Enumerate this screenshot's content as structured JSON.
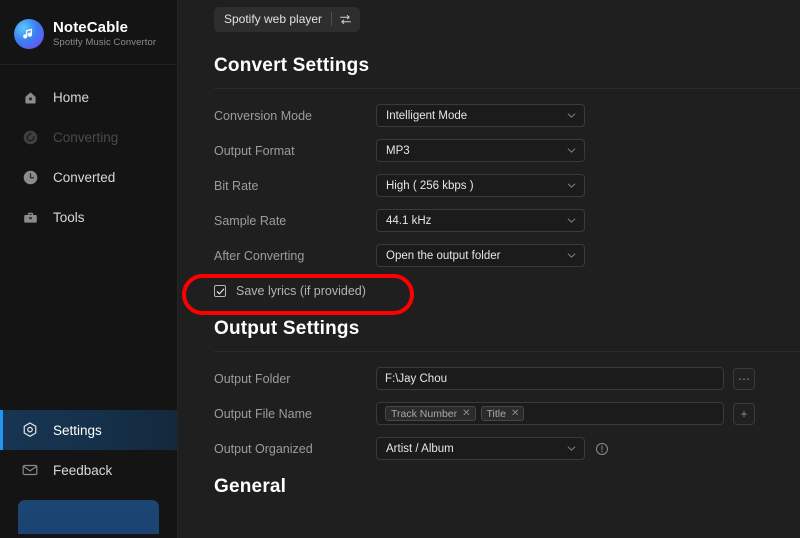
{
  "brand": {
    "name": "NoteCable",
    "tagline": "Spotify Music Convertor",
    "logo_icon": "music-note-circle-icon"
  },
  "sidebar": {
    "items": [
      {
        "label": "Home",
        "icon": "home-icon",
        "state": "normal"
      },
      {
        "label": "Converting",
        "icon": "refresh-circle-icon",
        "state": "disabled"
      },
      {
        "label": "Converted",
        "icon": "clock-icon",
        "state": "normal"
      },
      {
        "label": "Tools",
        "icon": "toolbox-icon",
        "state": "normal"
      }
    ],
    "bottom_items": [
      {
        "label": "Settings",
        "icon": "gear-hexagon-icon",
        "state": "active"
      },
      {
        "label": "Feedback",
        "icon": "envelope-icon",
        "state": "normal"
      }
    ],
    "accent_color": "#2196f3"
  },
  "topbar": {
    "player_label": "Spotify web player",
    "swap_icon": "swap-arrows-icon"
  },
  "convert_settings": {
    "heading": "Convert Settings",
    "rows": [
      {
        "label": "Conversion Mode",
        "value": "Intelligent Mode"
      },
      {
        "label": "Output Format",
        "value": "MP3"
      },
      {
        "label": "Bit Rate",
        "value": "High ( 256 kbps )"
      },
      {
        "label": "Sample Rate",
        "value": "44.1 kHz"
      },
      {
        "label": "After Converting",
        "value": "Open the output folder"
      }
    ],
    "save_lyrics": {
      "label": "Save lyrics (if provided)",
      "checked": true
    }
  },
  "output_settings": {
    "heading": "Output Settings",
    "output_folder": {
      "label": "Output Folder",
      "value": "F:\\Jay Chou",
      "browse_icon": "ellipsis-icon"
    },
    "output_file_name": {
      "label": "Output File Name",
      "chips": [
        "Track Number",
        "Title"
      ],
      "add_icon": "plus-icon"
    },
    "output_organized": {
      "label": "Output Organized",
      "value": "Artist  /  Album",
      "info_icon": "info-circle-icon"
    }
  },
  "general": {
    "heading": "General"
  },
  "annotation": {
    "color": "#ff0000",
    "target": "save-lyrics-checkbox-row"
  }
}
